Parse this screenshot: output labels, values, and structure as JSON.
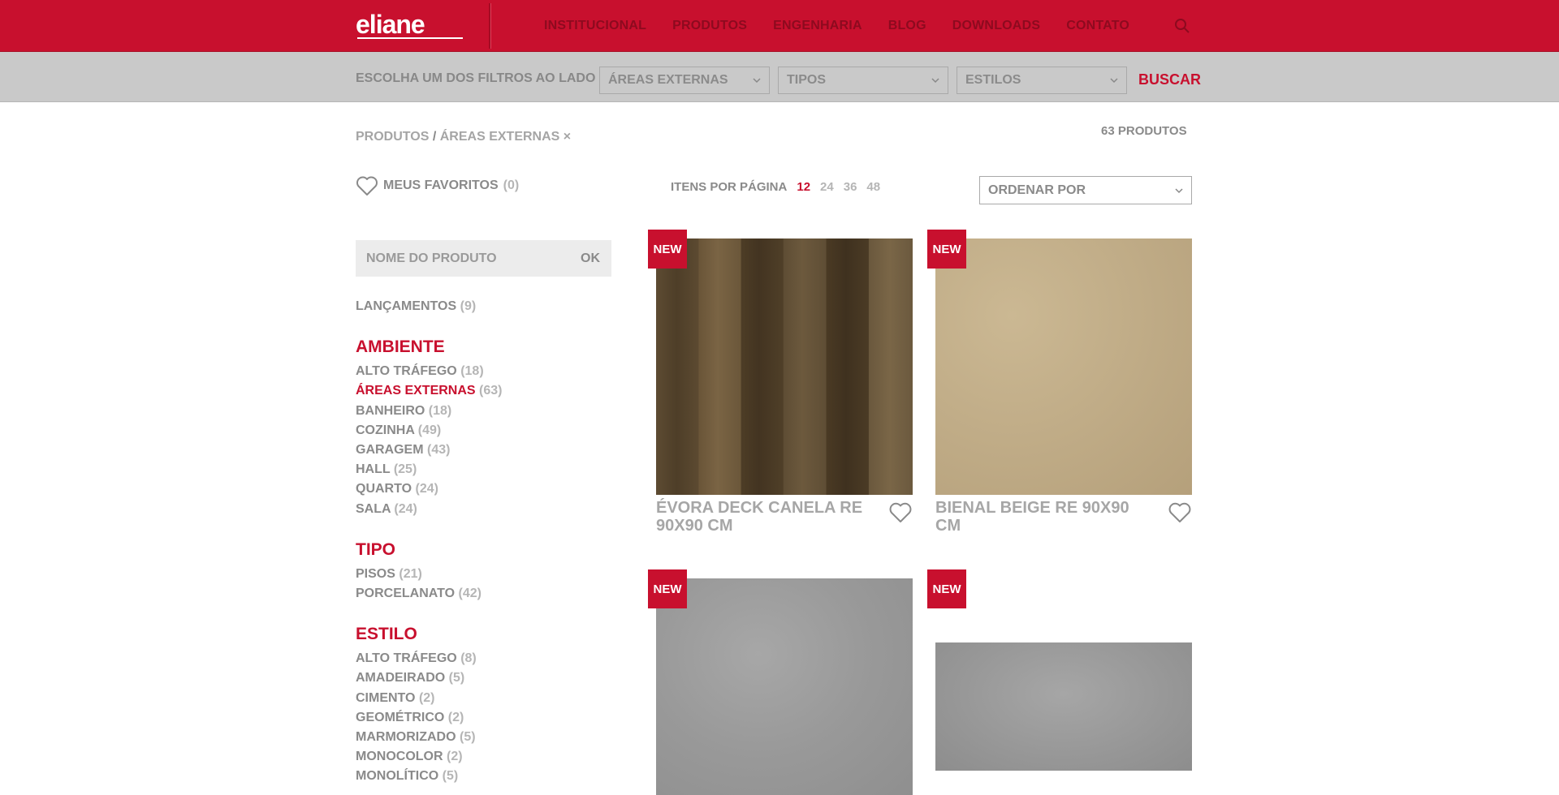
{
  "header": {
    "logo": "eliane",
    "nav": [
      "INSTITUCIONAL",
      "PRODUTOS",
      "ENGENHARIA",
      "BLOG",
      "DOWNLOADS",
      "CONTATO"
    ]
  },
  "filterbar": {
    "label": "ESCOLHA UM DOS FILTROS AO LADO",
    "selects": [
      "ÁREAS EXTERNAS",
      "TIPOS",
      "ESTILOS"
    ],
    "search_button": "BUSCAR"
  },
  "breadcrumb": {
    "root": "PRODUTOS",
    "separator": "/",
    "current": "ÁREAS EXTERNAS",
    "remove": "×"
  },
  "results_count": "63 PRODUTOS",
  "favorites": {
    "label": "MEUS FAVORITOS",
    "count": "(0)"
  },
  "name_search": {
    "placeholder": "NOME DO PRODUTO",
    "button": "OK"
  },
  "launches": {
    "label": "LANÇAMENTOS",
    "count": "(9)"
  },
  "facets": [
    {
      "title": "AMBIENTE",
      "items": [
        {
          "label": "ALTO TRÁFEGO",
          "count": "(18)"
        },
        {
          "label": "ÁREAS EXTERNAS",
          "count": "(63)",
          "active": true
        },
        {
          "label": "BANHEIRO",
          "count": "(18)"
        },
        {
          "label": "COZINHA",
          "count": "(49)"
        },
        {
          "label": "GARAGEM",
          "count": "(43)"
        },
        {
          "label": "HALL",
          "count": "(25)"
        },
        {
          "label": "QUARTO",
          "count": "(24)"
        },
        {
          "label": "SALA",
          "count": "(24)"
        }
      ]
    },
    {
      "title": "TIPO",
      "items": [
        {
          "label": "PISOS",
          "count": "(21)"
        },
        {
          "label": "PORCELANATO",
          "count": "(42)"
        }
      ]
    },
    {
      "title": "ESTILO",
      "items": [
        {
          "label": "ALTO TRÁFEGO",
          "count": "(8)"
        },
        {
          "label": "AMADEIRADO",
          "count": "(5)"
        },
        {
          "label": "CIMENTO",
          "count": "(2)"
        },
        {
          "label": "GEOMÉTRICO",
          "count": "(2)"
        },
        {
          "label": "MARMORIZADO",
          "count": "(5)"
        },
        {
          "label": "MONOCOLOR",
          "count": "(2)"
        },
        {
          "label": "MONOLÍTICO",
          "count": "(5)"
        }
      ]
    }
  ],
  "per_page": {
    "label": "ITENS POR PÁGINA",
    "options": [
      "12",
      "24",
      "36",
      "48"
    ],
    "selected": "12"
  },
  "order": {
    "label": "ORDENAR POR"
  },
  "products": [
    {
      "badge": "NEW",
      "name": "ÉVORA DECK CANELA RE 90X90 CM",
      "texture": "wood"
    },
    {
      "badge": "NEW",
      "name": "BIENAL BEIGE RE 90X90 CM",
      "texture": "beige"
    },
    {
      "badge": "NEW",
      "name": "",
      "texture": "stone"
    },
    {
      "badge": "NEW",
      "name": "",
      "texture": "stone2"
    }
  ],
  "colors": {
    "brand_red": "#c8102e",
    "filter_gray": "#c9c9c9",
    "text_gray": "#8a8a8a",
    "muted_gray": "#b5b5b5"
  }
}
